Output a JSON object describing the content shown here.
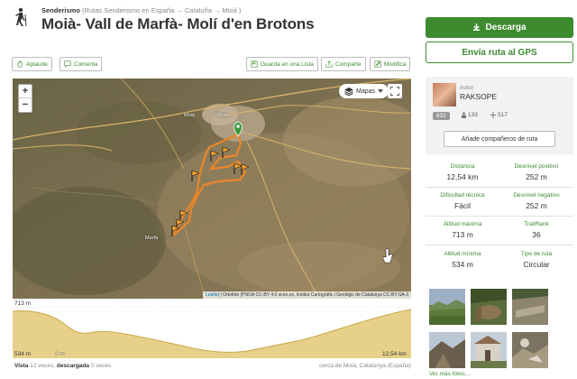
{
  "header": {
    "activity": "Senderismo",
    "breadcrumb": "(Rutas Senderismo en España → Cataluña → Moià )",
    "title": "Moià- Vall de Marfà- Molí d'en Brotons"
  },
  "actions": {
    "download": "Descarga",
    "send_gps": "Envía ruta al GPS",
    "like": "Aplaude",
    "comment": "Comenta",
    "save_list": "Guarda en una Lista",
    "share": "Comparte",
    "edit": "Modifica"
  },
  "map": {
    "layers_label": "Mapas",
    "zoom_in": "+",
    "zoom_out": "−",
    "attribution_link": "Leaflet",
    "attribution_text": "| Ortofoto (PNOA CC-BY 4.0 scne.es, Institut Cartogràfic i Geològic de Catalunya CC-BY-SA-3",
    "place_labels": [
      "Moià",
      "Moià",
      "Marfà"
    ],
    "colors": {
      "track": "#e8862a",
      "start_marker": "#3d9a3d"
    }
  },
  "profile": {
    "max_label": "713 m",
    "min_label": "534 m",
    "start_distance": "0 m",
    "end_distance": "12,54 km",
    "colors": {
      "fill": "#e7d08a",
      "line": "#c9a84a"
    }
  },
  "footer": {
    "views_prefix": "Vista",
    "views_text": "12 veces,",
    "downloads_prefix": "descargada",
    "downloads_text": "0 veces",
    "location": "cerca de Moià, Catalunya (España)"
  },
  "author": {
    "label": "Autor",
    "name": "RAKSOPE",
    "stats": [
      "632",
      "133",
      "517"
    ],
    "add_companions": "Añade compañeros de ruta"
  },
  "stats": [
    {
      "label": "Distancia",
      "value": "12,54 km"
    },
    {
      "label": "Desnivel positivo",
      "value": "252 m"
    },
    {
      "label": "Dificultad técnica",
      "value": "Fácil"
    },
    {
      "label": "Desnivel negativo",
      "value": "252 m"
    },
    {
      "label": "Altitud máxima",
      "value": "713 m"
    },
    {
      "label": "TrailRank",
      "value": "36"
    },
    {
      "label": "Altitud mínima",
      "value": "534 m"
    },
    {
      "label": "Tipo de ruta",
      "value": "Circular"
    }
  ],
  "photos": {
    "more_label": "Ver más fotos..."
  },
  "colors": {
    "brand_green": "#3d8b2f"
  }
}
